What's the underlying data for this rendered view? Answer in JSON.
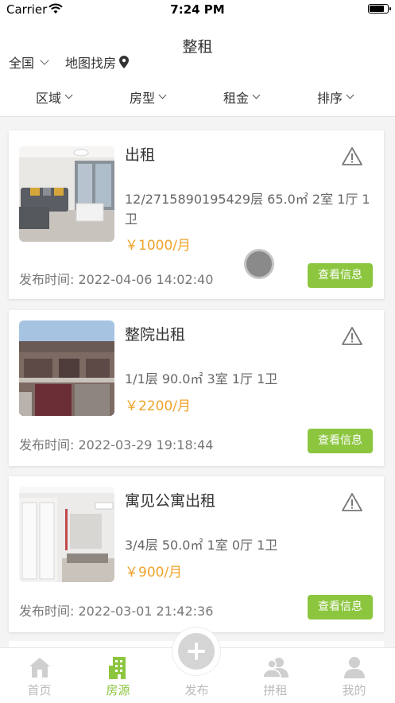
{
  "status_bar": {
    "carrier": "Carrier",
    "time": "7:24 PM"
  },
  "header": {
    "title": "整租",
    "city": "全国",
    "map_search": "地图找房"
  },
  "filters": [
    {
      "label": "区域"
    },
    {
      "label": "房型"
    },
    {
      "label": "租金"
    },
    {
      "label": "排序"
    }
  ],
  "listings": [
    {
      "title": "出租",
      "details": "12/2715890195429层  65.0㎡  2室 1厅 1卫",
      "price": "￥1000/月",
      "published": "发布时间: 2022-04-06 14:02:40",
      "button": "查看信息",
      "image": "living-room-photo"
    },
    {
      "title": "整院出租",
      "details": "1/1层  90.0㎡  3室 1厅 1卫",
      "price": "￥2200/月",
      "published": "发布时间: 2022-03-29 19:18:44",
      "button": "查看信息",
      "image": "courtyard-house-photo"
    },
    {
      "title": "寓见公寓出租",
      "details": "3/4层  50.0㎡  1室 0厅 1卫",
      "price": "￥900/月",
      "published": "发布时间: 2022-03-01 21:42:36",
      "button": "查看信息",
      "image": "apartment-room-photo"
    }
  ],
  "tabbar": {
    "items": [
      {
        "label": "首页",
        "icon": "home-icon"
      },
      {
        "label": "房源",
        "icon": "building-icon"
      },
      {
        "label": "发布",
        "icon": "plus-icon"
      },
      {
        "label": "拼租",
        "icon": "group-icon"
      },
      {
        "label": "我的",
        "icon": "person-icon"
      }
    ],
    "active_index": 1
  },
  "colors": {
    "accent": "#8cc63f",
    "price": "#f0a32b"
  }
}
